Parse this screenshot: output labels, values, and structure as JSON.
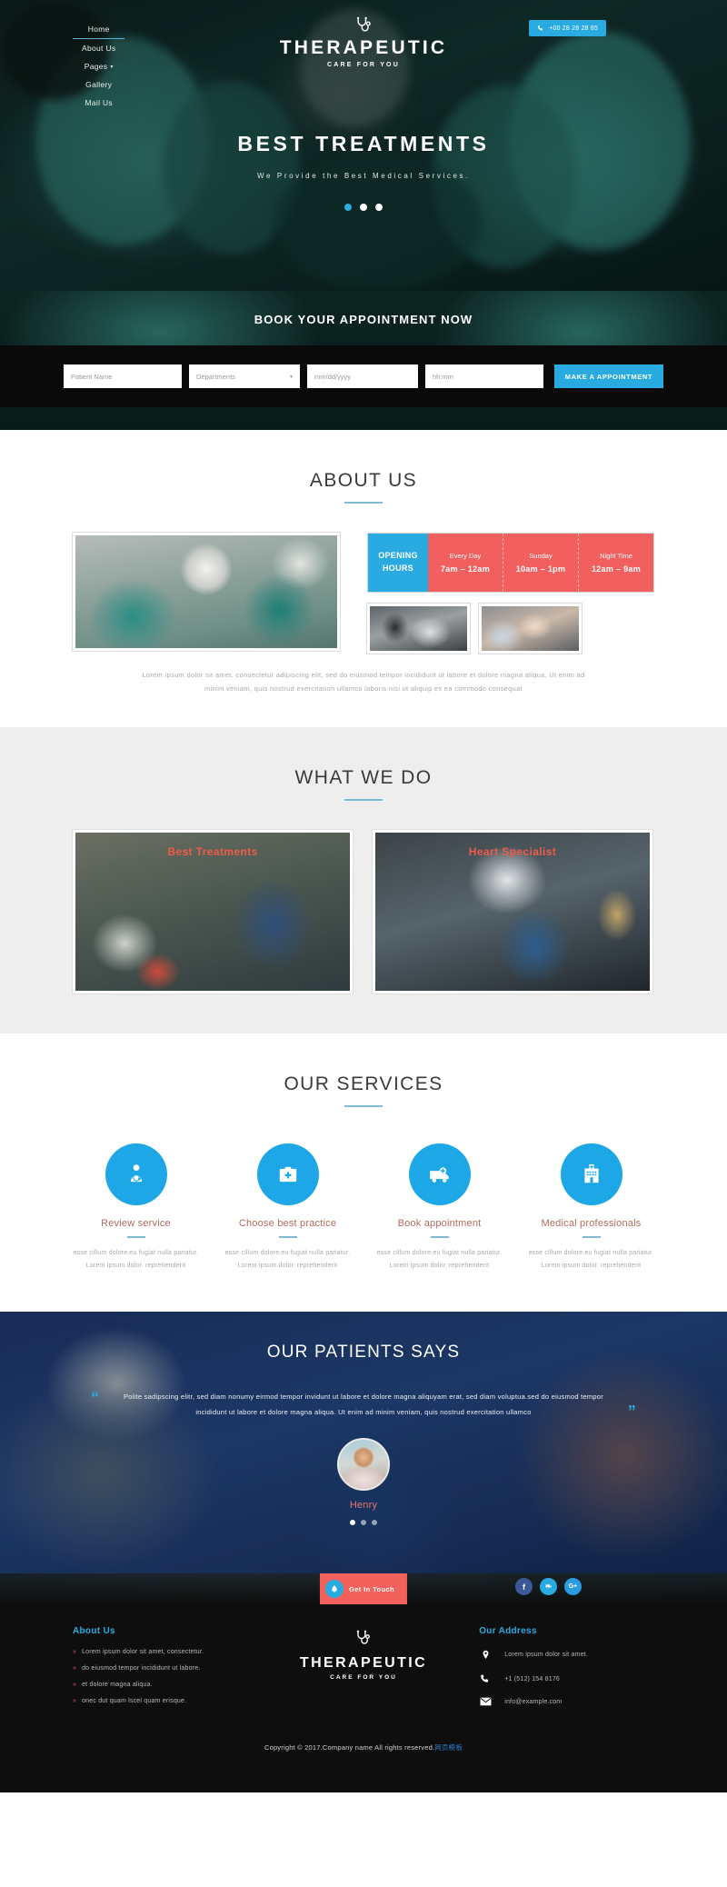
{
  "header": {
    "nav": [
      {
        "label": "Home",
        "active": true
      },
      {
        "label": "About Us",
        "active": false
      },
      {
        "label": "Pages",
        "active": false,
        "caret": "▾"
      },
      {
        "label": "Gallery",
        "active": false
      },
      {
        "label": "Mail Us",
        "active": false
      }
    ],
    "brand_title": "THERAPEUTIC",
    "brand_sub": "CARE FOR YOU",
    "phone": "+00 28 28 28 85"
  },
  "hero": {
    "heading": "BEST TREATMENTS",
    "subheading": "We Provide the Best Medical Services.",
    "slides": 3,
    "active_slide": 1
  },
  "booking": {
    "title": "BOOK YOUR APPOINTMENT NOW",
    "name_placeholder": "Patient Name",
    "department_value": "Departments",
    "date_placeholder": "mm/dd/yyyy",
    "time_placeholder": "hh:mm",
    "submit_label": "MAKE A APPOINTMENT"
  },
  "about": {
    "title": "ABOUT US",
    "hours_label_line1": "OPENING",
    "hours_label_line2": "HOURS",
    "hours": [
      {
        "day": "Every Day",
        "time": "7am – 12am"
      },
      {
        "day": "Sunday",
        "time": "10am – 1pm"
      },
      {
        "day": "Night Time",
        "time": "12am – 9am"
      }
    ],
    "paragraph": "Lorem ipsum dolor sit amet, consectetur adipiscing elit, sed do eiusmod tempor incididunt ut labore et dolore magna aliqua. Ut enim ad minim veniam, quis nostrud exercitation ullamco laboris nisi ut aliquip ex ea commodo consequat"
  },
  "what_we_do": {
    "title": "WHAT WE DO",
    "cards": [
      {
        "label": "Best Treatments"
      },
      {
        "label": "Heart Specialist"
      }
    ]
  },
  "services": {
    "title": "OUR SERVICES",
    "items": [
      {
        "icon": "doctor-icon",
        "name": "Review service",
        "desc": "esse cillum dolore eu fugiat nulla pariatur. Lorem ipsum dolor. reprehenderit"
      },
      {
        "icon": "medical-kit-icon",
        "name": "Choose best practice",
        "desc": "esse cillum dolore eu fugiat nulla pariatur. Lorem ipsum dolor. reprehenderit"
      },
      {
        "icon": "ambulance-icon",
        "name": "Book appointment",
        "desc": "esse cillum dolore eu fugiat nulla pariatur. Lorem ipsum dolor. reprehenderit"
      },
      {
        "icon": "hospital-icon",
        "name": "Medical professionals",
        "desc": "esse cillum dolore eu fugiat nulla pariatur. Lorem ipsum dolor. reprehenderit"
      }
    ]
  },
  "testimonial": {
    "title": "OUR PATIENTS SAYS",
    "quote": "Polite sadipscing elitr, sed diam nonumy eirmod tempor invidunt ut labore et dolore magna aliquyam erat, sed diam voluptua.sed do eiusmod tempor incididunt ut labore et dolore magna aliqua. Ut enim ad minim veniam, quis nostrud exercitation ullamco",
    "quote_open": "“",
    "quote_close": "”",
    "name": "Henry",
    "slides": 3,
    "active_slide": 0
  },
  "footer": {
    "get_in_touch": "Get In Touch",
    "social": [
      {
        "name": "facebook",
        "glyph": "f",
        "color": "#3b5998"
      },
      {
        "name": "twitter",
        "glyph": "❧",
        "color": "#29abe2"
      },
      {
        "name": "google-plus",
        "glyph": "G+",
        "color": "#2a9ce0"
      }
    ],
    "about": {
      "heading": "About Us",
      "links": [
        "Lorem ipsum dolor sit amet, consectetur.",
        "do eiusmod tempor incididunt ut labore.",
        "et dolore magna aliqua.",
        "onec dut quam lscel quam erisque."
      ],
      "arrow": "»"
    },
    "brand_title": "THERAPEUTIC",
    "brand_sub": "CARE FOR YOU",
    "address": {
      "heading": "Our Address",
      "rows": [
        {
          "icon": "location-pin-icon",
          "text": "Lorem ipsum dolor sit amet."
        },
        {
          "icon": "phone-icon",
          "text": "+1 (512) 154 8176"
        },
        {
          "icon": "envelope-icon",
          "text": "info@example.com"
        }
      ]
    },
    "copyright_main": "Copyright © 2017.Company name All rights reserved.",
    "copyright_cn": "网页模板"
  }
}
